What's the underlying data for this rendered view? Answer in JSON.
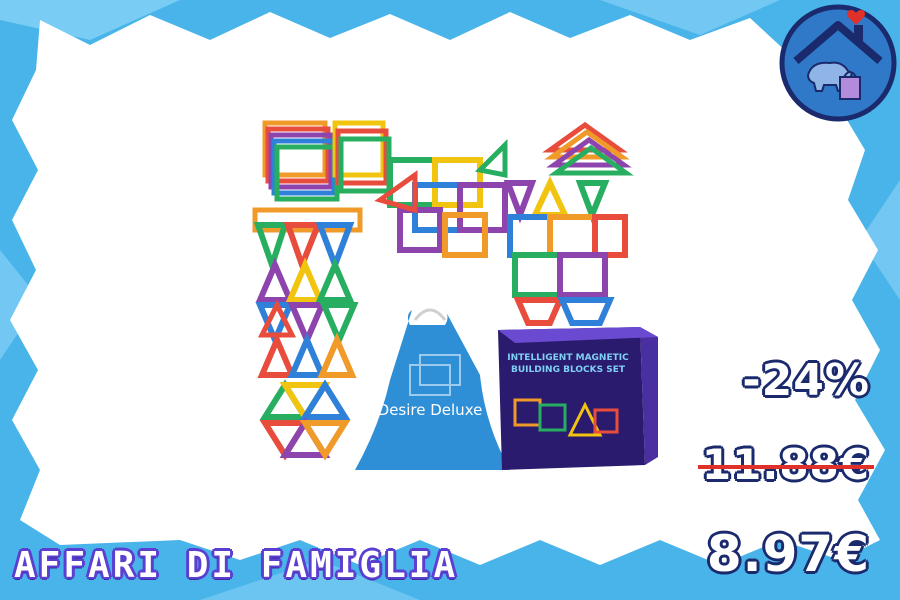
{
  "colors": {
    "frame_blue": "#2aa0e0",
    "frame_light": "#7fd0f5",
    "price_outline": "#1a2a6c",
    "strike": "#e0302a",
    "brand_outline": "#5b3fd1",
    "logo_bg": "#2f79c8",
    "logo_ring": "#1a2a6c",
    "heart": "#e0302a"
  },
  "product": {
    "bag_text": "Desire Deluxe",
    "box_title_line1": "INTELLIGENT MAGNETIC",
    "box_title_line2": "BUILDING BLOCKS SET"
  },
  "pricing": {
    "discount": "-24%",
    "old_price": "11.88€",
    "new_price": "8.97€"
  },
  "brand": {
    "name": "AFFARI DI FAMIGLIA"
  },
  "icons": {
    "logo": "house-piggybank-logo-icon",
    "heart": "heart-icon"
  }
}
